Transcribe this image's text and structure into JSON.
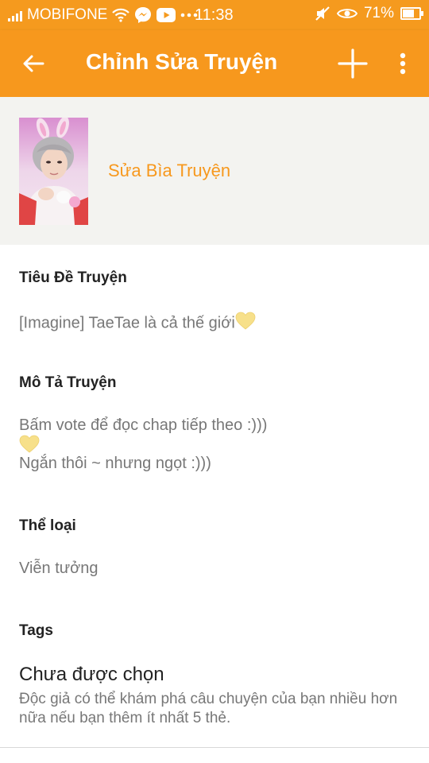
{
  "status_bar": {
    "carrier": "MOBIFONE",
    "time": "11:38",
    "battery_percent": "71%",
    "battery_level": 0.71,
    "icons": [
      "signal-icon",
      "wifi-icon",
      "messenger-icon",
      "youtube-icon",
      "more-notifications-icon",
      "mute-icon",
      "eye-icon",
      "battery-icon"
    ]
  },
  "app_bar": {
    "title": "Chỉnh Sửa Truyện",
    "icons": [
      "back-arrow-icon",
      "plus-icon",
      "more-vert-icon"
    ]
  },
  "cover": {
    "edit_label": "Sửa Bìa Truyện"
  },
  "fields": {
    "title_label": "Tiêu Đề Truyện",
    "title_value": "[Imagine] TaeTae là cả thế giới",
    "description_label": "Mô Tả Truyện",
    "description_line1": "Bấm vote để đọc chap tiếp theo :)))",
    "description_line2": "Ngắn thôi ~ nhưng ngọt :)))",
    "genre_label": "Thể loại",
    "genre_value": "Viễn tưởng",
    "tags_label": "Tags",
    "tags_value": "Chưa được chọn",
    "tags_hint": "Độc giả có thể khám phá câu chuyện của bạn nhiều hơn nữa nếu bạn thêm ít nhất 5 thẻ."
  },
  "colors": {
    "accent": "#f7981d",
    "heart": "#f7e08a"
  }
}
